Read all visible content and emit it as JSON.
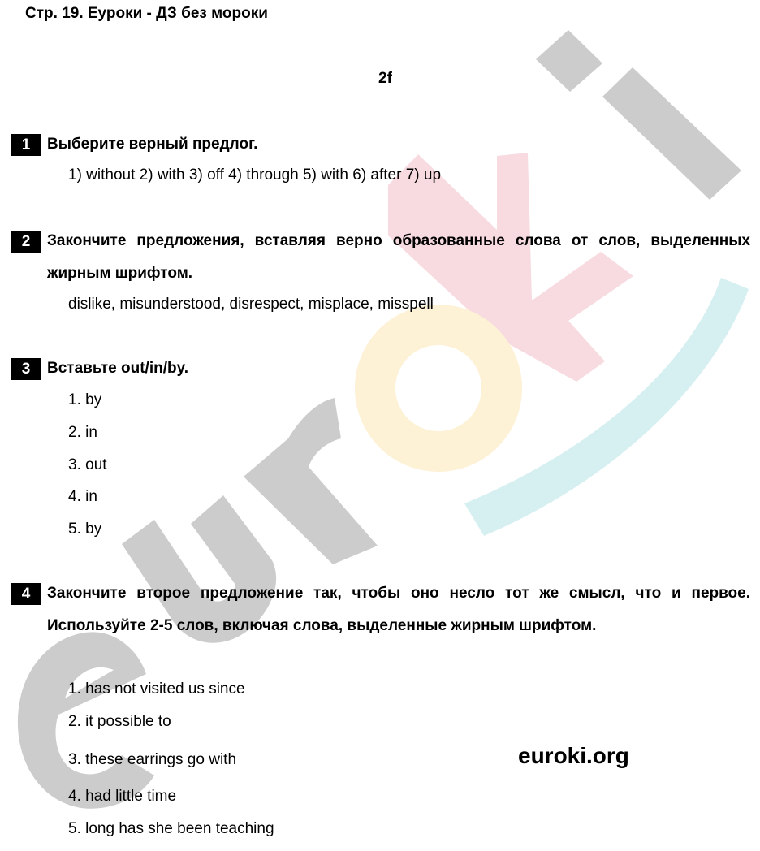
{
  "page_header": "Стр. 19. Еуроки - ДЗ без мороки",
  "section_code": "2f",
  "tasks": [
    {
      "number": "1",
      "title": "Выберите верный предлог.",
      "answer": "1) without 2) with 3) off 4) through 5) with 6) after 7) up"
    },
    {
      "number": "2",
      "title": "Закончите предложения, вставляя верно образованные слова от слов, выделенных жирным шрифтом.",
      "answer": "dislike, misunderstood, disrespect, misplace, misspell"
    },
    {
      "number": "3",
      "title": "Вставьте out/in/by.",
      "items": [
        "1. by",
        "2. in",
        "3. out",
        "4. in",
        "5. by"
      ]
    },
    {
      "number": "4",
      "title": "Закончите второе предложение так, чтобы оно несло тот же смысл, что и первое. Используйте 2-5 слов, включая слова, выделенные жирным шрифтом.",
      "items": [
        "1. has not visited us since",
        "2. it possible to",
        "3. these earrings go with",
        "4. had little time",
        "5. long has she been teaching"
      ]
    }
  ],
  "site_label": "euroki.org",
  "watermark": {
    "text": "euroki",
    "colors": {
      "gray": "#cccccc",
      "red": "#f7dbe0",
      "yellow": "#fdf1d6",
      "cyan": "#d6eff1"
    }
  }
}
